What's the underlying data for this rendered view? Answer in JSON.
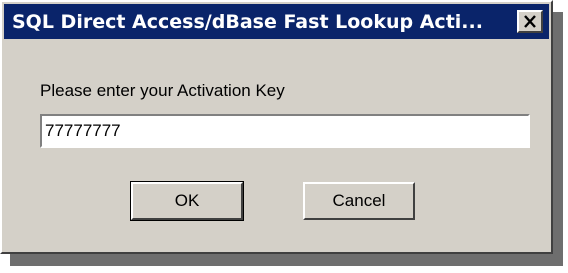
{
  "window": {
    "title": "SQL Direct Access/dBase Fast Lookup Acti...",
    "close_icon": "close-x-icon"
  },
  "form": {
    "prompt": "Please enter your Activation Key",
    "activation_key_value": "77777777"
  },
  "buttons": {
    "ok_label": "OK",
    "cancel_label": "Cancel"
  },
  "colors": {
    "titlebar": "#0a246a",
    "dialog_face": "#d4d0c8",
    "shadow": "#6e6e6e"
  }
}
